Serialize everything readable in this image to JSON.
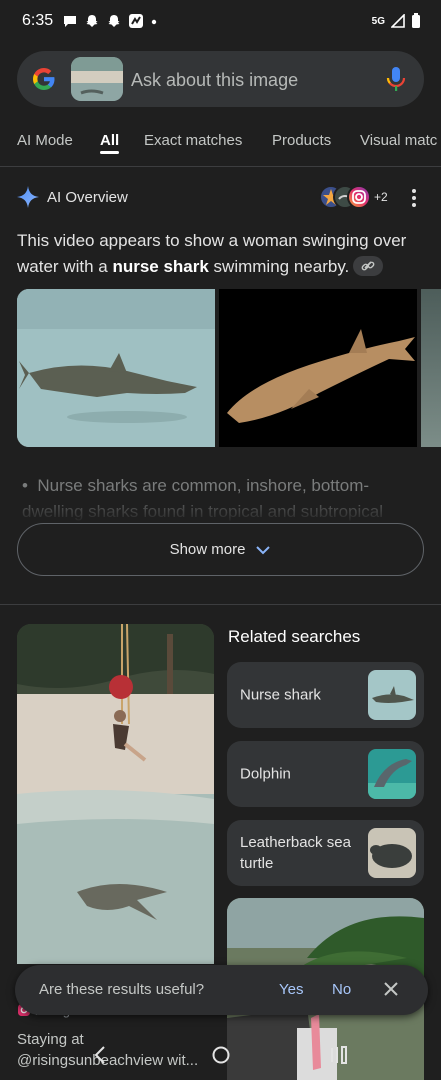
{
  "status_bar": {
    "time": "6:35",
    "network": "5G"
  },
  "search": {
    "placeholder": "Ask about this image"
  },
  "tabs": [
    {
      "label": "AI Mode"
    },
    {
      "label": "All"
    },
    {
      "label": "Exact matches"
    },
    {
      "label": "Products"
    },
    {
      "label": "Visual matc"
    }
  ],
  "ai_overview": {
    "title": "AI Overview",
    "source_count": "+2",
    "summary_pre": "This video appears to show a woman swinging over water with a ",
    "summary_bold": "nurse shark",
    "summary_post": " swimming nearby.",
    "bullet": "Nurse sharks are common, inshore, bottom-dwelling sharks found in tropical and subtropical",
    "show_more": "Show more"
  },
  "related": {
    "title": "Related searches",
    "items": [
      {
        "label": "Nurse shark"
      },
      {
        "label": "Dolphin"
      },
      {
        "label": "Leatherback sea turtle"
      }
    ]
  },
  "result": {
    "source": "Instagram",
    "caption": "Staying at @risingsunbeachview wit..."
  },
  "feedback": {
    "question": "Are these results useful?",
    "yes": "Yes",
    "no": "No"
  },
  "colors": {
    "background": "#1f1f1f",
    "surface": "#333537",
    "accent": "#a8c7fa"
  }
}
